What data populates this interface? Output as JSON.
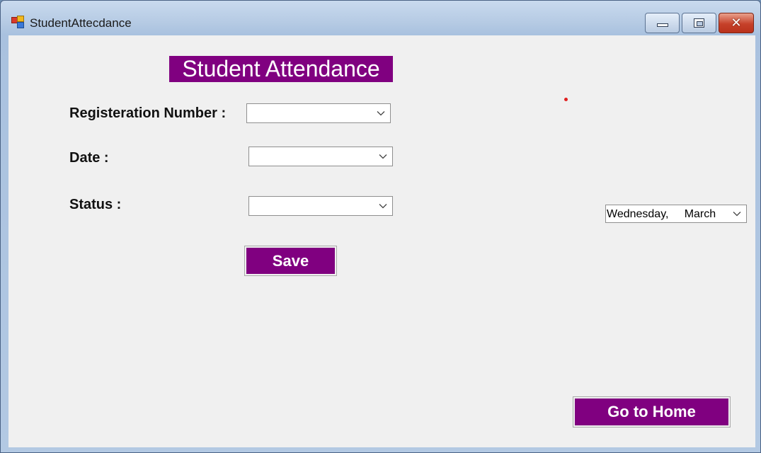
{
  "window": {
    "title": "StudentAttecdance",
    "minimize_icon": "minimize-icon",
    "maximize_icon": "maximize-icon",
    "close_icon": "close-icon"
  },
  "form": {
    "heading": "Student Attendance",
    "registration_label": "Registeration Number :",
    "registration_value": "",
    "date_label": "Date :",
    "date_value": "",
    "status_label": "Status :",
    "status_value": "",
    "save_label": "Save",
    "date_picker_value": "Wednesday,     March",
    "home_label": "Go to Home"
  },
  "colors": {
    "accent": "#800080",
    "background": "#f0f0f0"
  }
}
